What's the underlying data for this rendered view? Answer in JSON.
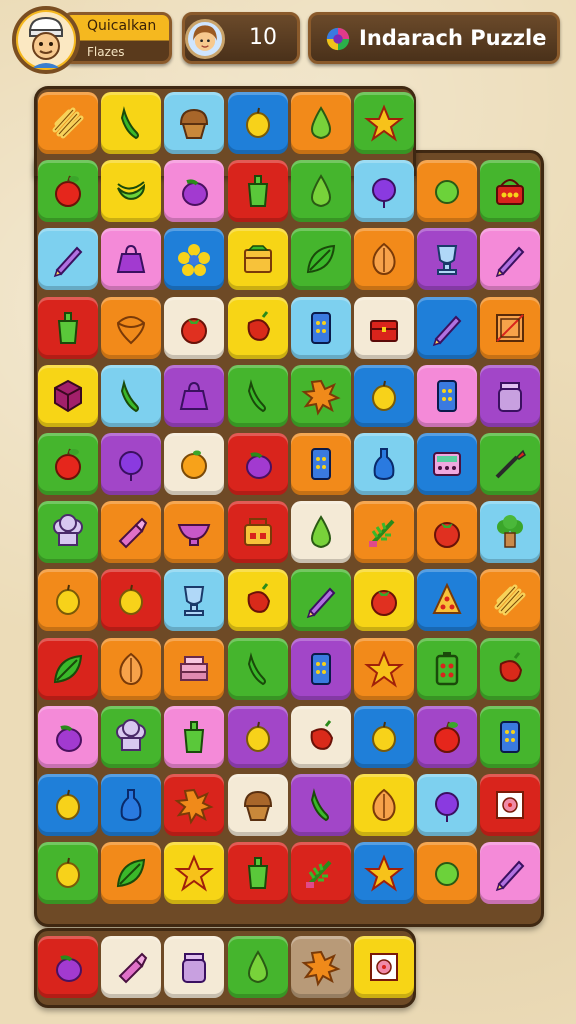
{
  "hud": {
    "player_name": "Quicalkan",
    "player_subtitle": "Flazes",
    "moves": "10",
    "title": "Indarach Puzzle"
  },
  "colors": {
    "orange": "#f28a1a",
    "yellow": "#f7d516",
    "lightblue": "#7dd0ef",
    "blue": "#1f7fd9",
    "green": "#45b52d",
    "red": "#d9241c",
    "pink": "#f48ad8",
    "purple": "#a246c8",
    "cream": "#f4ead6",
    "tan": "#b89a78"
  },
  "board": {
    "rows": [
      [
        [
          "orange",
          "fries-icon"
        ],
        [
          "yellow",
          "chili-icon"
        ],
        [
          "lightblue",
          "muffin-icon"
        ],
        [
          "blue",
          "lemon-icon"
        ],
        [
          "orange",
          "pear-icon"
        ],
        [
          "green",
          "star-icon"
        ]
      ],
      [
        [
          "green",
          "apple-icon"
        ],
        [
          "yellow",
          "banana-icon"
        ],
        [
          "pink",
          "eggplant-icon"
        ],
        [
          "red",
          "cup-icon"
        ],
        [
          "green",
          "pear-icon"
        ],
        [
          "lightblue",
          "plum-icon"
        ],
        [
          "orange",
          "lime-icon"
        ],
        [
          "green",
          "basket-icon"
        ]
      ],
      [
        [
          "lightblue",
          "pencil-icon"
        ],
        [
          "pink",
          "bag-icon"
        ],
        [
          "blue",
          "flower-icon"
        ],
        [
          "yellow",
          "box-icon"
        ],
        [
          "green",
          "leaf-icon"
        ],
        [
          "orange",
          "onion-icon"
        ],
        [
          "purple",
          "trophy-icon"
        ],
        [
          "pink",
          "pencil-icon"
        ]
      ],
      [
        [
          "red",
          "cup-icon"
        ],
        [
          "orange",
          "spinning-top-icon"
        ],
        [
          "cream",
          "tomato-icon"
        ],
        [
          "yellow",
          "pepper-icon"
        ],
        [
          "lightblue",
          "phone-icon"
        ],
        [
          "cream",
          "chest-icon"
        ],
        [
          "blue",
          "pencil-icon"
        ],
        [
          "orange",
          "picture-icon"
        ]
      ],
      [
        [
          "yellow",
          "cube-icon"
        ],
        [
          "lightblue",
          "chili-icon"
        ],
        [
          "purple",
          "bag-icon"
        ],
        [
          "green",
          "chili-icon"
        ],
        [
          "green",
          "splat-icon"
        ],
        [
          "blue",
          "lemon-icon"
        ],
        [
          "pink",
          "phone-icon"
        ],
        [
          "purple",
          "jar-icon"
        ]
      ],
      [
        [
          "green",
          "apple-icon"
        ],
        [
          "purple",
          "plum-icon"
        ],
        [
          "cream",
          "orange-icon"
        ],
        [
          "red",
          "eggplant-icon"
        ],
        [
          "orange",
          "phone-icon"
        ],
        [
          "lightblue",
          "bottle-icon"
        ],
        [
          "blue",
          "calculator-icon"
        ],
        [
          "green",
          "brush-icon"
        ]
      ],
      [
        [
          "green",
          "chef-hat-icon"
        ],
        [
          "orange",
          "lipstick-icon"
        ],
        [
          "orange",
          "bowl-icon"
        ],
        [
          "red",
          "toaster-icon"
        ],
        [
          "cream",
          "pear-icon"
        ],
        [
          "orange",
          "herb-icon"
        ],
        [
          "orange",
          "tomato-icon"
        ],
        [
          "lightblue",
          "broccoli-icon"
        ]
      ],
      [
        [
          "orange",
          "lemon-icon"
        ],
        [
          "red",
          "lemon-icon"
        ],
        [
          "lightblue",
          "trophy-icon"
        ],
        [
          "yellow",
          "pepper-icon"
        ],
        [
          "green",
          "pencil-icon"
        ],
        [
          "yellow",
          "tomato-icon"
        ],
        [
          "blue",
          "pizza-icon"
        ],
        [
          "orange",
          "fries-icon"
        ]
      ],
      [
        [
          "red",
          "leaf-icon"
        ],
        [
          "orange",
          "onion-icon"
        ],
        [
          "orange",
          "cake-icon"
        ],
        [
          "green",
          "chili-icon"
        ],
        [
          "purple",
          "phone-icon"
        ],
        [
          "orange",
          "star-icon"
        ],
        [
          "green",
          "battery-icon"
        ],
        [
          "green",
          "pepper-icon"
        ]
      ],
      [
        [
          "pink",
          "eggplant-icon"
        ],
        [
          "green",
          "chef-hat-icon"
        ],
        [
          "pink",
          "cup-icon"
        ],
        [
          "purple",
          "lemon-icon"
        ],
        [
          "cream",
          "pepper-icon"
        ],
        [
          "blue",
          "lemon-icon"
        ],
        [
          "purple",
          "apple-icon"
        ],
        [
          "green",
          "phone-icon"
        ]
      ],
      [
        [
          "blue",
          "lemon-icon"
        ],
        [
          "blue",
          "bottle-icon"
        ],
        [
          "red",
          "splat-icon"
        ],
        [
          "cream",
          "muffin-icon"
        ],
        [
          "purple",
          "chili-icon"
        ],
        [
          "yellow",
          "onion-icon"
        ],
        [
          "lightblue",
          "plum-icon"
        ],
        [
          "red",
          "stamp-icon"
        ]
      ],
      [
        [
          "green",
          "lemon-icon"
        ],
        [
          "orange",
          "leaf-icon"
        ],
        [
          "yellow",
          "star-icon"
        ],
        [
          "red",
          "cup-icon"
        ],
        [
          "red",
          "herb-icon"
        ],
        [
          "blue",
          "star-icon"
        ],
        [
          "orange",
          "lime-icon"
        ],
        [
          "pink",
          "pencil-icon"
        ]
      ]
    ],
    "tray": [
      [
        "red",
        "eggplant-icon"
      ],
      [
        "cream",
        "lipstick-icon"
      ],
      [
        "cream",
        "jar-icon"
      ],
      [
        "green",
        "pear-icon"
      ],
      [
        "tan",
        "splat-icon"
      ],
      [
        "yellow",
        "stamp-icon"
      ]
    ]
  }
}
